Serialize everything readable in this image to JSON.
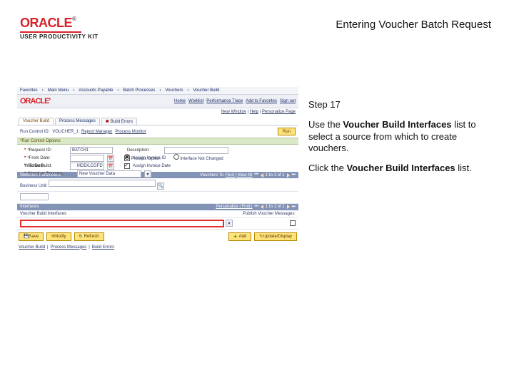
{
  "header": {
    "brand": "ORACLE",
    "subbrand": "USER PRODUCTIVITY KIT",
    "doc_title": "Entering Voucher Batch Request"
  },
  "instructions": {
    "step_label": "Step 17",
    "para1_a": "Use the ",
    "para1_b": "Voucher Build Interfaces",
    "para1_c": " list to select a source from which to create vouchers.",
    "para2_a": "Click the ",
    "para2_b": "Voucher Build Interfaces",
    "para2_c": " list."
  },
  "shot": {
    "menubar": [
      "Favorites",
      "Main Menu",
      "Accounts Payable",
      "Batch Processes",
      "Vouchers",
      "Voucher Build"
    ],
    "brand": "ORACLE'",
    "top_links": [
      "Home",
      "Worklist",
      "Performance Trace",
      "Add to Favorites",
      "Sign out"
    ],
    "subnav": [
      "New Window",
      "Help",
      "Personalize Page"
    ],
    "tabs": [
      {
        "label": "Voucher Build",
        "active": true
      },
      {
        "label": "Process Messages",
        "active": false
      },
      {
        "label": "Build Errors",
        "active": false,
        "err": true
      }
    ],
    "runid_lbl": "Run Control ID:",
    "runid_val": "VOUCHER_1",
    "runid_links": [
      "Report Manager",
      "Process Monitor"
    ],
    "run_btn": "Run",
    "sec_run_ctrl": "*Run Control Options",
    "form": {
      "request_id_lbl": "*Request ID:",
      "request_id_val": "BATCH1",
      "description_lbl": "Description:",
      "description_val": "",
      "from_date_lbl": "*From Date:",
      "from_date_val": "",
      "assign_invoice_lbl": "Assign Invoice ID",
      "to_date_lbl": "*To Date:",
      "to_date_val": "",
      "assign_date_lbl": "Assign Invoice Date",
      "vsources_lbl": "*Voucher Sources:",
      "vsources_val": "New Voucher Data",
      "radio1": "Process Option",
      "radio2": "Interface Not Changed",
      "vb_lbl": "Voucher Build:",
      "vb_val": "MDD/LCGFD"
    },
    "sec_selection": "Selection Parameters",
    "pager1": {
      "label": "Vouchers To",
      "range": "1 to 1 of 1"
    },
    "pager1_link": "Find | View All",
    "row1_lbl": "Business Unit:",
    "row1_val": "",
    "pager2": {
      "label": "Personalize | Find | ",
      "range": "1 to 1 of 1"
    },
    "sec_interfaces": "Interfaces",
    "interfaces_lbl": "Voucher Build Interfaces",
    "publish_lbl": "Publish Voucher Messages:",
    "buttons": {
      "save": "Save",
      "notify": "Notify",
      "refresh": "Refresh",
      "add": "Add",
      "update": "Update/Display"
    },
    "crumb": [
      "Voucher Build",
      "Process Messages",
      "Build Errors"
    ]
  }
}
